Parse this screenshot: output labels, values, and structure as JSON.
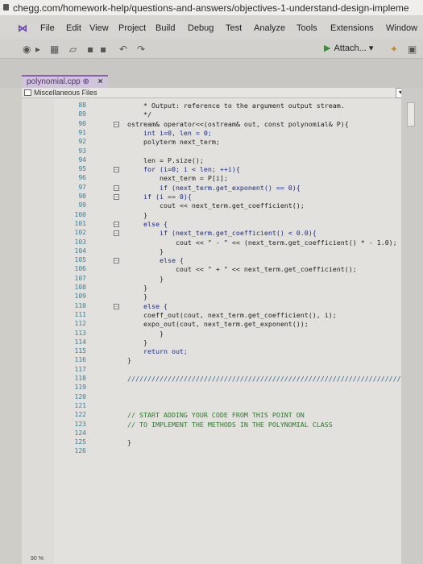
{
  "browser": {
    "url": "chegg.com/homework-help/questions-and-answers/objectives-1-understand-design-impleme"
  },
  "menu": {
    "items": [
      "File",
      "Edit",
      "View",
      "Project",
      "Build",
      "Debug",
      "Test",
      "Analyze",
      "Tools",
      "Extensions",
      "Window"
    ]
  },
  "toolbar": {
    "attach_label": "Attach...",
    "attach_icon": "play-icon"
  },
  "tab": {
    "filename": "polynomial.cpp",
    "pin": "⊕",
    "close": "×"
  },
  "navbar": {
    "scope": "Miscellaneous Files"
  },
  "editor": {
    "lines": [
      {
        "n": "88",
        "text": "    * Output: reference to the argument output stream."
      },
      {
        "n": "89",
        "text": "    */"
      },
      {
        "n": "90",
        "text": "ostream& operator<<(ostream& out, const polynomial& P){"
      },
      {
        "n": "91",
        "text": "    int i=0, len = 0;"
      },
      {
        "n": "92",
        "text": "    polyterm next_term;"
      },
      {
        "n": "93",
        "text": ""
      },
      {
        "n": "94",
        "text": "    len = P.size();"
      },
      {
        "n": "95",
        "text": "    for (i=0; i < len; ++i){"
      },
      {
        "n": "96",
        "text": "        next_term = P[i];"
      },
      {
        "n": "97",
        "text": "        if (next_term.get_exponent() == 0){"
      },
      {
        "n": "98",
        "text": "    if (i == 0){"
      },
      {
        "n": "99",
        "text": "        cout << next_term.get_coefficient();"
      },
      {
        "n": "100",
        "text": "    }"
      },
      {
        "n": "101",
        "text": "    else {"
      },
      {
        "n": "102",
        "text": "        if (next_term.get_coefficient() < 0.0){"
      },
      {
        "n": "103",
        "text": "            cout << \" - \" << (next_term.get_coefficient() * - 1.0);"
      },
      {
        "n": "104",
        "text": "        }"
      },
      {
        "n": "105",
        "text": "        else {"
      },
      {
        "n": "106",
        "text": "            cout << \" + \" << next_term.get_coefficient();"
      },
      {
        "n": "107",
        "text": "        }"
      },
      {
        "n": "108",
        "text": "    }"
      },
      {
        "n": "109",
        "text": "    }"
      },
      {
        "n": "110",
        "text": "    else {"
      },
      {
        "n": "111",
        "text": "    coeff_out(cout, next_term.get_coefficient(), i);"
      },
      {
        "n": "112",
        "text": "    expo_out(cout, next_term.get_exponent());"
      },
      {
        "n": "113",
        "text": "        }"
      },
      {
        "n": "114",
        "text": "    }"
      },
      {
        "n": "115",
        "text": "    return out;"
      },
      {
        "n": "116",
        "text": "}"
      },
      {
        "n": "117",
        "text": ""
      },
      {
        "n": "118",
        "text": "///////////////////////////////////////////////////////////////////////"
      },
      {
        "n": "119",
        "text": ""
      },
      {
        "n": "120",
        "text": ""
      },
      {
        "n": "121",
        "text": ""
      },
      {
        "n": "122",
        "text": "// START ADDING YOUR CODE FROM THIS POINT ON"
      },
      {
        "n": "123",
        "text": "// TO IMPLEMENT THE METHODS IN THE POLYNOMIAL CLASS"
      },
      {
        "n": "124",
        "text": ""
      },
      {
        "n": "125",
        "text": "}"
      },
      {
        "n": "126",
        "text": ""
      }
    ]
  },
  "status": {
    "zoom": "90 %"
  },
  "colors": {
    "line_number": "#3a7f98",
    "keyword": "#1c2fb5",
    "comment": "#2d7a2d",
    "tab_accent": "#8a5fb0"
  }
}
